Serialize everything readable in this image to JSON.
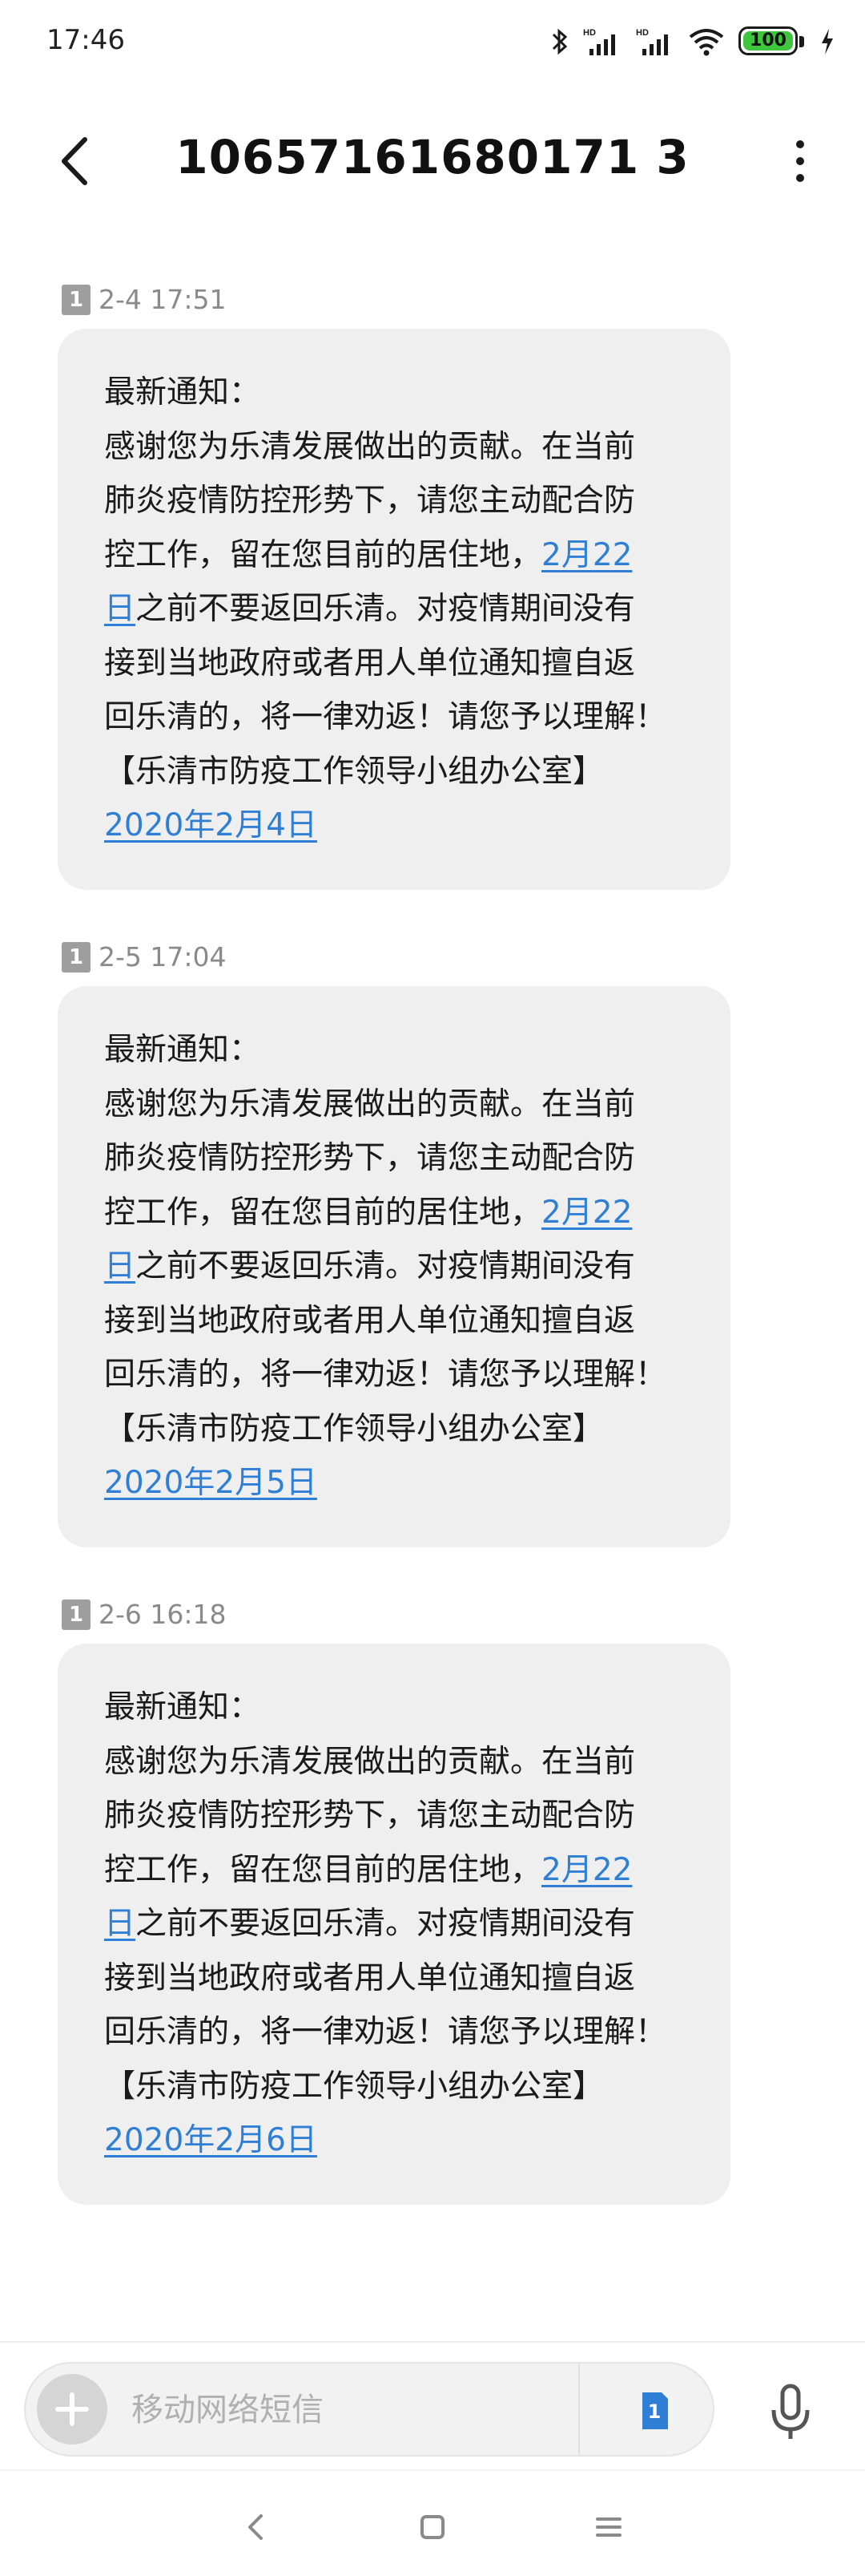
{
  "status_bar": {
    "time": "17:46",
    "battery_level": "100",
    "icons": [
      "bluetooth-icon",
      "hd-signal-icon",
      "hd-signal-icon",
      "wifi-icon",
      "battery-icon",
      "charging-icon"
    ]
  },
  "header": {
    "contact_number": "10657161680171 3",
    "contact_display": "10657161680171 3"
  },
  "messages": [
    {
      "sim": "1",
      "time": "2-4 17:51",
      "lines": {
        "l1": "最新通知：",
        "l2": "感谢您为乐清发展做出的贡献。在当前",
        "l3": "肺炎疫情防控形势下，请您主动配合防",
        "l4_text": "控工作，留在您目前的居住地，",
        "l4_link": "2月22",
        "l5_link": "日",
        "l5_text": "之前不要返回乐清。对疫情期间没有",
        "l6": "接到当地政府或者用人单位通知擅自返",
        "l7": "回乐清的，将一律劝返！请您予以理解！",
        "l8": "【乐清市防疫工作领导小组办公室】",
        "l9_link": "2020年2月4日"
      }
    },
    {
      "sim": "1",
      "time": "2-5 17:04",
      "lines": {
        "l1": "最新通知：",
        "l2": "感谢您为乐清发展做出的贡献。在当前",
        "l3": "肺炎疫情防控形势下，请您主动配合防",
        "l4_text": "控工作，留在您目前的居住地，",
        "l4_link": "2月22",
        "l5_link": "日",
        "l5_text": "之前不要返回乐清。对疫情期间没有",
        "l6": "接到当地政府或者用人单位通知擅自返",
        "l7": "回乐清的，将一律劝返！请您予以理解！",
        "l8": "【乐清市防疫工作领导小组办公室】",
        "l9_link": "2020年2月5日"
      }
    },
    {
      "sim": "1",
      "time": "2-6 16:18",
      "lines": {
        "l1": "最新通知：",
        "l2": "感谢您为乐清发展做出的贡献。在当前",
        "l3": "肺炎疫情防控形势下，请您主动配合防",
        "l4_text": "控工作，留在您目前的居住地，",
        "l4_link": "2月22",
        "l5_link": "日",
        "l5_text": "之前不要返回乐清。对疫情期间没有",
        "l6": "接到当地政府或者用人单位通知擅自返",
        "l7": "回乐清的，将一律劝返！请您予以理解！",
        "l8": "【乐清市防疫工作领导小组办公室】",
        "l9_link": "2020年2月6日"
      }
    }
  ],
  "compose": {
    "placeholder": "移动网络短信",
    "value": "",
    "sim_label": "1"
  },
  "colors": {
    "link": "#2f7fd6",
    "bubble": "#efefef",
    "battery_fill": "#3ec63e"
  }
}
